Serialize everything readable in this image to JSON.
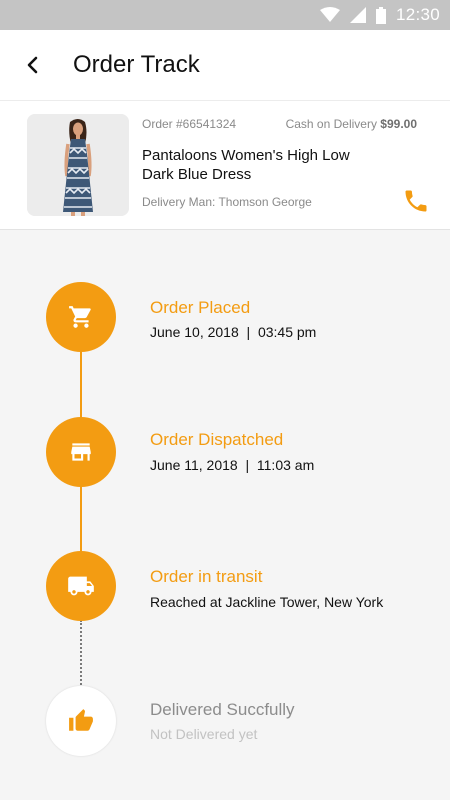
{
  "status_bar": {
    "time": "12:30"
  },
  "header": {
    "title": "Order Track"
  },
  "order": {
    "id": "Order #66541324",
    "payment_label": "Cash on Delivery",
    "payment_amount": "$99.00",
    "product_name": "Pantaloons Women's High Low Dark Blue Dress",
    "delivery_man": "Delivery Man: Thomson George"
  },
  "colors": {
    "accent": "#f39c12",
    "pending_title": "#8c8c8c",
    "pending_sub": "#c2c2c2"
  },
  "steps": [
    {
      "title": "Order Placed",
      "subtitle": "June 10, 2018  |  03:45 pm",
      "icon": "cart-icon",
      "status": "done"
    },
    {
      "title": "Order Dispatched",
      "subtitle": "June 11, 2018  |  11:03 am",
      "icon": "store-icon",
      "status": "done"
    },
    {
      "title": "Order in transit",
      "subtitle": "Reached at Jackline Tower, New York",
      "icon": "truck-icon",
      "status": "current"
    },
    {
      "title": "Delivered Succfully",
      "subtitle": "Not Delivered yet",
      "icon": "thumbs-up-icon",
      "status": "pending"
    }
  ]
}
